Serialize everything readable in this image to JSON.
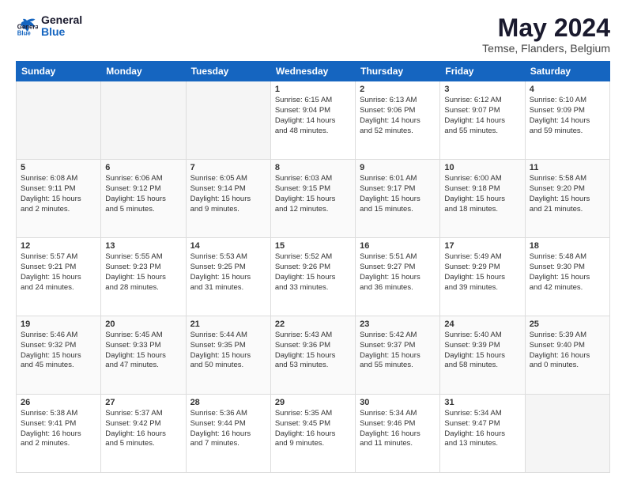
{
  "logo": {
    "line1": "General",
    "line2": "Blue"
  },
  "title": "May 2024",
  "subtitle": "Temse, Flanders, Belgium",
  "days_header": [
    "Sunday",
    "Monday",
    "Tuesday",
    "Wednesday",
    "Thursday",
    "Friday",
    "Saturday"
  ],
  "weeks": [
    [
      {
        "day": "",
        "info": ""
      },
      {
        "day": "",
        "info": ""
      },
      {
        "day": "",
        "info": ""
      },
      {
        "day": "1",
        "info": "Sunrise: 6:15 AM\nSunset: 9:04 PM\nDaylight: 14 hours\nand 48 minutes."
      },
      {
        "day": "2",
        "info": "Sunrise: 6:13 AM\nSunset: 9:06 PM\nDaylight: 14 hours\nand 52 minutes."
      },
      {
        "day": "3",
        "info": "Sunrise: 6:12 AM\nSunset: 9:07 PM\nDaylight: 14 hours\nand 55 minutes."
      },
      {
        "day": "4",
        "info": "Sunrise: 6:10 AM\nSunset: 9:09 PM\nDaylight: 14 hours\nand 59 minutes."
      }
    ],
    [
      {
        "day": "5",
        "info": "Sunrise: 6:08 AM\nSunset: 9:11 PM\nDaylight: 15 hours\nand 2 minutes."
      },
      {
        "day": "6",
        "info": "Sunrise: 6:06 AM\nSunset: 9:12 PM\nDaylight: 15 hours\nand 5 minutes."
      },
      {
        "day": "7",
        "info": "Sunrise: 6:05 AM\nSunset: 9:14 PM\nDaylight: 15 hours\nand 9 minutes."
      },
      {
        "day": "8",
        "info": "Sunrise: 6:03 AM\nSunset: 9:15 PM\nDaylight: 15 hours\nand 12 minutes."
      },
      {
        "day": "9",
        "info": "Sunrise: 6:01 AM\nSunset: 9:17 PM\nDaylight: 15 hours\nand 15 minutes."
      },
      {
        "day": "10",
        "info": "Sunrise: 6:00 AM\nSunset: 9:18 PM\nDaylight: 15 hours\nand 18 minutes."
      },
      {
        "day": "11",
        "info": "Sunrise: 5:58 AM\nSunset: 9:20 PM\nDaylight: 15 hours\nand 21 minutes."
      }
    ],
    [
      {
        "day": "12",
        "info": "Sunrise: 5:57 AM\nSunset: 9:21 PM\nDaylight: 15 hours\nand 24 minutes."
      },
      {
        "day": "13",
        "info": "Sunrise: 5:55 AM\nSunset: 9:23 PM\nDaylight: 15 hours\nand 28 minutes."
      },
      {
        "day": "14",
        "info": "Sunrise: 5:53 AM\nSunset: 9:25 PM\nDaylight: 15 hours\nand 31 minutes."
      },
      {
        "day": "15",
        "info": "Sunrise: 5:52 AM\nSunset: 9:26 PM\nDaylight: 15 hours\nand 33 minutes."
      },
      {
        "day": "16",
        "info": "Sunrise: 5:51 AM\nSunset: 9:27 PM\nDaylight: 15 hours\nand 36 minutes."
      },
      {
        "day": "17",
        "info": "Sunrise: 5:49 AM\nSunset: 9:29 PM\nDaylight: 15 hours\nand 39 minutes."
      },
      {
        "day": "18",
        "info": "Sunrise: 5:48 AM\nSunset: 9:30 PM\nDaylight: 15 hours\nand 42 minutes."
      }
    ],
    [
      {
        "day": "19",
        "info": "Sunrise: 5:46 AM\nSunset: 9:32 PM\nDaylight: 15 hours\nand 45 minutes."
      },
      {
        "day": "20",
        "info": "Sunrise: 5:45 AM\nSunset: 9:33 PM\nDaylight: 15 hours\nand 47 minutes."
      },
      {
        "day": "21",
        "info": "Sunrise: 5:44 AM\nSunset: 9:35 PM\nDaylight: 15 hours\nand 50 minutes."
      },
      {
        "day": "22",
        "info": "Sunrise: 5:43 AM\nSunset: 9:36 PM\nDaylight: 15 hours\nand 53 minutes."
      },
      {
        "day": "23",
        "info": "Sunrise: 5:42 AM\nSunset: 9:37 PM\nDaylight: 15 hours\nand 55 minutes."
      },
      {
        "day": "24",
        "info": "Sunrise: 5:40 AM\nSunset: 9:39 PM\nDaylight: 15 hours\nand 58 minutes."
      },
      {
        "day": "25",
        "info": "Sunrise: 5:39 AM\nSunset: 9:40 PM\nDaylight: 16 hours\nand 0 minutes."
      }
    ],
    [
      {
        "day": "26",
        "info": "Sunrise: 5:38 AM\nSunset: 9:41 PM\nDaylight: 16 hours\nand 2 minutes."
      },
      {
        "day": "27",
        "info": "Sunrise: 5:37 AM\nSunset: 9:42 PM\nDaylight: 16 hours\nand 5 minutes."
      },
      {
        "day": "28",
        "info": "Sunrise: 5:36 AM\nSunset: 9:44 PM\nDaylight: 16 hours\nand 7 minutes."
      },
      {
        "day": "29",
        "info": "Sunrise: 5:35 AM\nSunset: 9:45 PM\nDaylight: 16 hours\nand 9 minutes."
      },
      {
        "day": "30",
        "info": "Sunrise: 5:34 AM\nSunset: 9:46 PM\nDaylight: 16 hours\nand 11 minutes."
      },
      {
        "day": "31",
        "info": "Sunrise: 5:34 AM\nSunset: 9:47 PM\nDaylight: 16 hours\nand 13 minutes."
      },
      {
        "day": "",
        "info": ""
      }
    ]
  ]
}
